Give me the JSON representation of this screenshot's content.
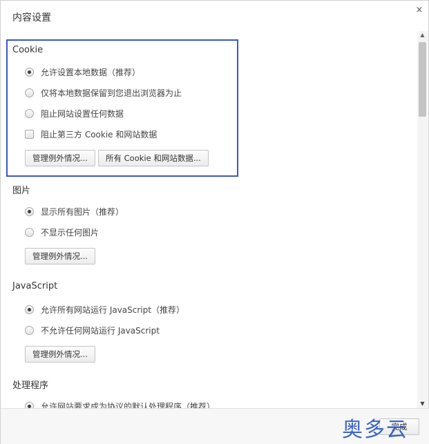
{
  "dialog": {
    "title": "内容设置",
    "close_glyph": "×"
  },
  "cookie": {
    "title": "Cookie",
    "options": [
      {
        "label": "允许设置本地数据（推荐）",
        "type": "radio",
        "checked": true
      },
      {
        "label": "仅将本地数据保留到您退出浏览器为止",
        "type": "radio",
        "checked": false
      },
      {
        "label": "阻止网站设置任何数据",
        "type": "radio",
        "checked": false
      },
      {
        "label": "阻止第三方 Cookie 和网站数据",
        "type": "checkbox",
        "checked": false
      }
    ],
    "manage_button": "管理例外情况...",
    "all_cookies_button": "所有 Cookie 和网站数据..."
  },
  "images": {
    "title": "图片",
    "options": [
      {
        "label": "显示所有图片（推荐）",
        "type": "radio",
        "checked": true
      },
      {
        "label": "不显示任何图片",
        "type": "radio",
        "checked": false
      }
    ],
    "manage_button": "管理例外情况..."
  },
  "javascript": {
    "title": "JavaScript",
    "options": [
      {
        "label": "允许所有网站运行 JavaScript（推荐）",
        "type": "radio",
        "checked": true
      },
      {
        "label": "不允许任何网站运行 JavaScript",
        "type": "radio",
        "checked": false
      }
    ],
    "manage_button": "管理例外情况..."
  },
  "handlers": {
    "title": "处理程序",
    "options": [
      {
        "label": "允许网站要求成为协议的默认处理程序（推荐）",
        "type": "radio",
        "checked": true
      }
    ]
  },
  "footer": {
    "done_label": "完成",
    "watermark": "奥多云"
  },
  "colors": {
    "highlight_border": "#3a57c4",
    "watermark": "#2f5cc7"
  },
  "icons": {
    "close": "close-icon",
    "scroll_up": "scroll-up-arrow-icon",
    "scroll_down": "scroll-down-arrow-icon"
  }
}
